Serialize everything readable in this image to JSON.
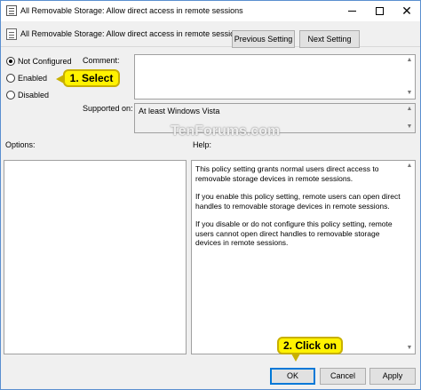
{
  "window": {
    "title": "All Removable Storage: Allow direct access in remote sessions",
    "minimize": "",
    "maximize": "",
    "close": "✕"
  },
  "header": {
    "setting_name": "All Removable Storage: Allow direct access in remote sessions",
    "prev_button": "Previous Setting",
    "next_button": "Next Setting"
  },
  "state": {
    "options": [
      {
        "label": "Not Configured",
        "selected": true
      },
      {
        "label": "Enabled",
        "selected": false
      },
      {
        "label": "Disabled",
        "selected": false
      }
    ]
  },
  "comment": {
    "label": "Comment:",
    "value": ""
  },
  "supported": {
    "label": "Supported on:",
    "value": "At least Windows Vista"
  },
  "options_label": "Options:",
  "help": {
    "label": "Help:",
    "paragraphs": [
      "This policy setting grants normal users direct access to removable storage devices in remote sessions.",
      "If you enable this policy setting, remote users can open direct handles to removable storage devices in remote sessions.",
      "If you disable or do not configure this policy setting, remote users cannot open direct handles to removable storage devices in remote sessions."
    ]
  },
  "buttons": {
    "ok": "OK",
    "cancel": "Cancel",
    "apply": "Apply"
  },
  "annotations": {
    "callout_select": "1. Select",
    "callout_click": "2. Click on"
  },
  "watermark": "TenForums.com",
  "colors": {
    "callout_fill": "#fff200",
    "default_button_border": "#0078d7",
    "window_border": "#5a8fd0"
  }
}
